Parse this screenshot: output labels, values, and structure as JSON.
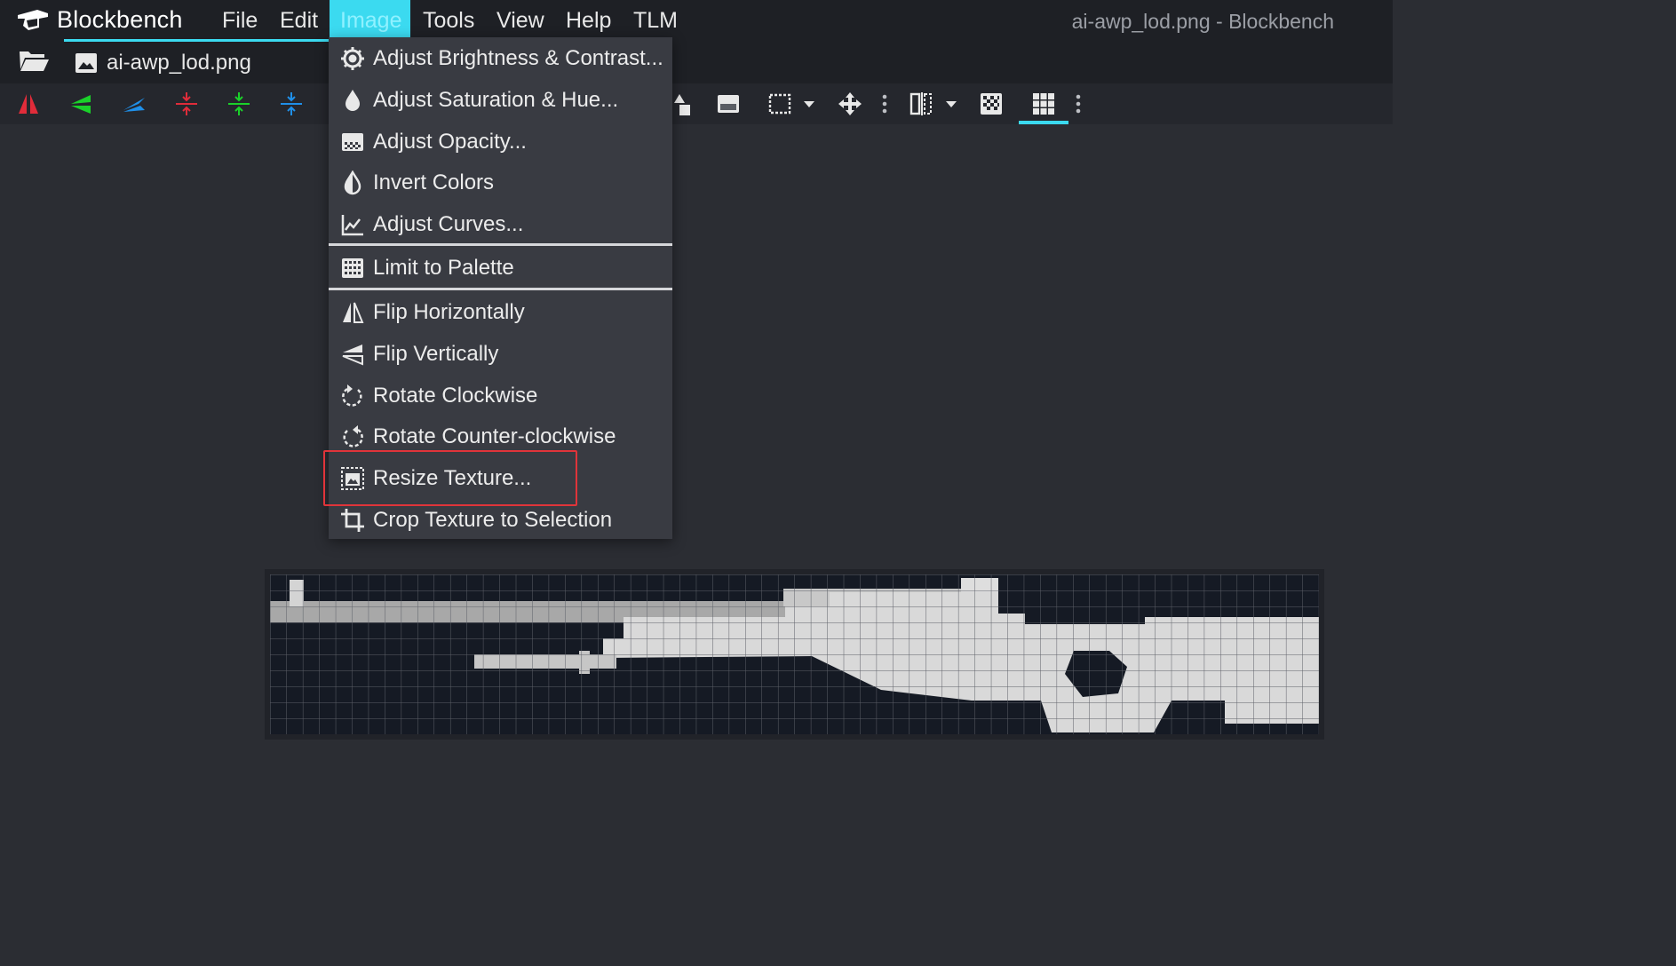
{
  "app": {
    "name": "Blockbench",
    "window_title": "ai-awp_lod.png - Blockbench"
  },
  "menubar": {
    "items": [
      "File",
      "Edit",
      "Image",
      "Tools",
      "View",
      "Help",
      "TLM"
    ],
    "active": "Image"
  },
  "tabs": [
    {
      "label": "ai-awp_lod.png",
      "icon": "image-icon",
      "active": true
    }
  ],
  "toolbar": {
    "left_tools": [
      {
        "name": "mirror-x-icon",
        "color": "#e02c3a"
      },
      {
        "name": "mirror-y-icon",
        "color": "#1ad12a"
      },
      {
        "name": "mirror-z-icon",
        "color": "#1f8fe8"
      },
      {
        "name": "center-x-icon",
        "color": "#e02c3a"
      },
      {
        "name": "center-y-icon",
        "color": "#1ad12a"
      },
      {
        "name": "center-z-icon",
        "color": "#1f8fe8"
      }
    ],
    "right_tools": [
      "fill-icon",
      "opacity-icon",
      "selection-rect-icon",
      "dropdown-caret-icon",
      "move-icon",
      "kebab-icon",
      "mirror-painting-icon",
      "dropdown-caret-icon",
      "checkerboard-icon",
      "grid-icon",
      "kebab-icon"
    ],
    "selected_tool": "grid-icon"
  },
  "image_menu": {
    "items": [
      {
        "label": "Adjust Brightness & Contrast...",
        "icon": "brightness-icon"
      },
      {
        "label": "Adjust Saturation & Hue...",
        "icon": "drop-icon"
      },
      {
        "label": "Adjust Opacity...",
        "icon": "opacity-icon"
      },
      {
        "label": "Invert Colors",
        "icon": "invert-icon"
      },
      {
        "label": "Adjust Curves...",
        "icon": "curves-icon"
      },
      {
        "label": "Limit to Palette",
        "icon": "palette-grid-icon"
      },
      {
        "label": "Flip Horizontally",
        "icon": "flip-horizontal-icon"
      },
      {
        "label": "Flip Vertically",
        "icon": "flip-vertical-icon"
      },
      {
        "label": "Rotate Clockwise",
        "icon": "rotate-cw-icon"
      },
      {
        "label": "Rotate Counter-clockwise",
        "icon": "rotate-ccw-icon"
      },
      {
        "label": "Resize Texture...",
        "icon": "resize-texture-icon"
      },
      {
        "label": "Crop Texture to Selection",
        "icon": "crop-icon"
      }
    ],
    "highlighted": "Resize Texture..."
  },
  "colors": {
    "accent": "#3bdaf0",
    "menubar_bg": "#1e2025",
    "menu_bg": "#393b42",
    "workspace_bg": "#2b2d33",
    "highlight_border": "#e0343a",
    "texture_light": "#d9d9d9",
    "texture_dark": "#141923"
  }
}
